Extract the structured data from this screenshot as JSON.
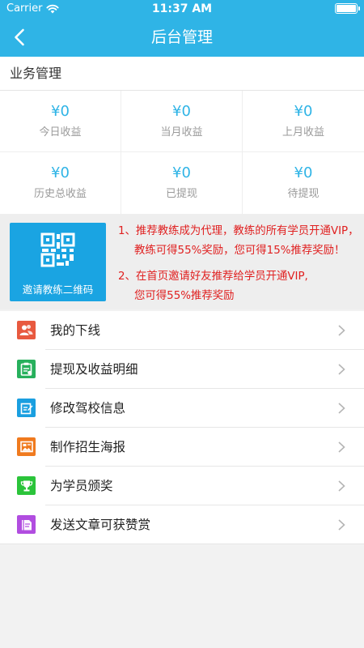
{
  "status": {
    "carrier": "Carrier",
    "time": "11:37 AM"
  },
  "nav": {
    "title": "后台管理"
  },
  "section": {
    "title": "业务管理"
  },
  "stats": [
    {
      "value": "¥0",
      "label": "今日收益"
    },
    {
      "value": "¥0",
      "label": "当月收益"
    },
    {
      "value": "¥0",
      "label": "上月收益"
    },
    {
      "value": "¥0",
      "label": "历史总收益"
    },
    {
      "value": "¥0",
      "label": "已提现"
    },
    {
      "value": "¥0",
      "label": "待提现"
    }
  ],
  "invite": {
    "button_label": "邀请教练二维码",
    "lines": [
      "1、推荐教练成为代理，教练的所有学员开通VIP，",
      "教练可得55%奖励，您可得15%推荐奖励！",
      "2、在首页邀请好友推荐给学员开通VIP,",
      "您可得55%推荐奖励"
    ]
  },
  "menu": [
    {
      "label": "我的下线",
      "icon": "users-icon",
      "color": "#e8593f"
    },
    {
      "label": "提现及收益明细",
      "icon": "clipboard-icon",
      "color": "#27b05c"
    },
    {
      "label": "修改驾校信息",
      "icon": "edit-icon",
      "color": "#1a9fe0"
    },
    {
      "label": "制作招生海报",
      "icon": "poster-icon",
      "color": "#f07a1e"
    },
    {
      "label": "为学员颁奖",
      "icon": "trophy-icon",
      "color": "#2bc43a"
    },
    {
      "label": "发送文章可获赞赏",
      "icon": "book-icon",
      "color": "#b14de0"
    }
  ],
  "colors": {
    "accent": "#2fb4e6",
    "invite_text": "#e02020",
    "qr_button": "#1aa4e2"
  }
}
